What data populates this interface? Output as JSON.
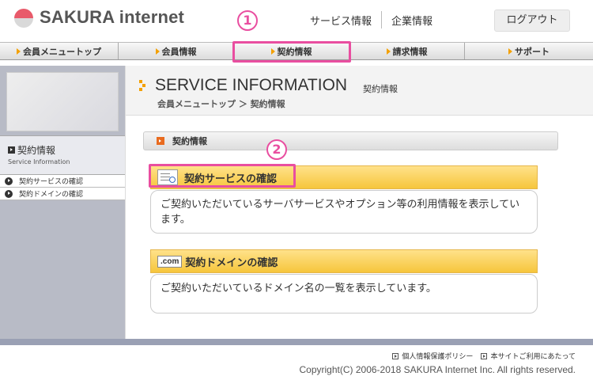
{
  "header": {
    "logo_text": "SAKURA internet",
    "links": [
      "サービス情報",
      "企業情報"
    ],
    "logout_label": "ログアウト"
  },
  "nav": {
    "items": [
      "会員メニュートップ",
      "会員情報",
      "契約情報",
      "請求情報",
      "サポート"
    ],
    "active_index": 2
  },
  "annotations": [
    "1",
    "2"
  ],
  "sidebar": {
    "section_title": "契約情報",
    "section_subtitle": "Service Information",
    "links": [
      "契約サービスの確認",
      "契約ドメインの確認"
    ]
  },
  "page": {
    "title": "SERVICE INFORMATION",
    "title_sub": "契約情報",
    "breadcrumb": "会員メニュートップ ＞ 契約情報",
    "section_label": "契約情報"
  },
  "cards": [
    {
      "icon": "document-search-icon",
      "title": "契約サービスの確認",
      "body": "ご契約いただいているサーバサービスやオプション等の利用情報を表示しています。"
    },
    {
      "icon": "com-badge-icon",
      "badge": ".com",
      "title": "契約ドメインの確認",
      "body": "ご契約いただいているドメイン名の一覧を表示しています。"
    }
  ],
  "footer": {
    "links": [
      "個人情報保護ポリシー",
      "本サイトご利用にあたって"
    ],
    "copyright": "Copyright(C) 2006-2018 SAKURA Internet Inc. All rights reserved."
  },
  "colors": {
    "highlight": "#e94ea0",
    "accent_orange": "#f3a000",
    "card_header": "#f6c63c"
  }
}
